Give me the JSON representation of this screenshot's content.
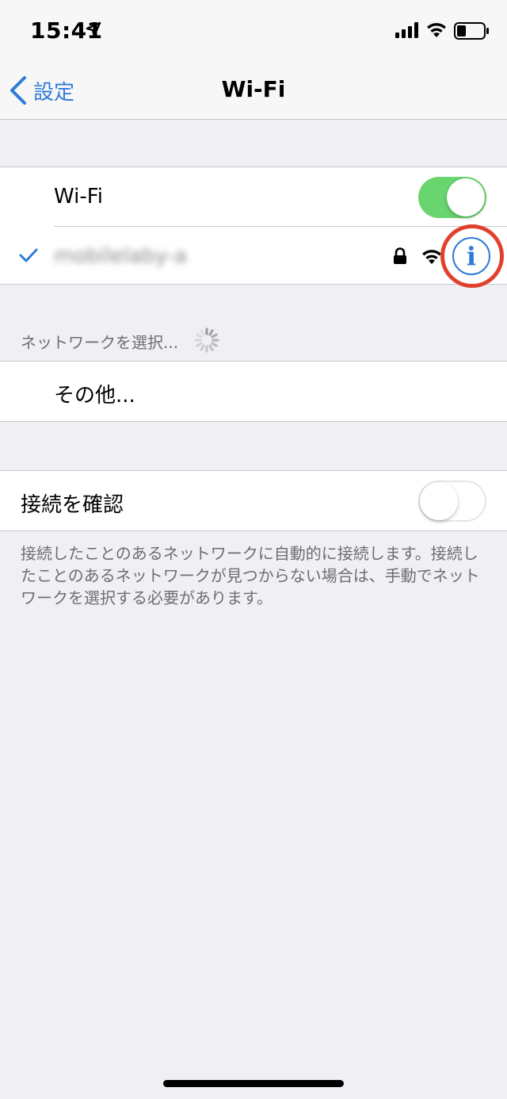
{
  "status_bar": {
    "time": "15:41",
    "icons": [
      "location-arrow-icon",
      "cellular-signal-icon",
      "wifi-icon",
      "battery-icon"
    ]
  },
  "nav": {
    "back_label": "設定",
    "title": "Wi-Fi"
  },
  "wifi_section": {
    "toggle_label": "Wi-Fi",
    "toggle_on": true,
    "connected_network": "mobilelaby-a"
  },
  "networks_section": {
    "header": "ネットワークを選択...",
    "other_label": "その他..."
  },
  "ask_section": {
    "label": "接続を確認",
    "toggle_on": false,
    "footer": "接続したことのあるネットワークに自動的に接続します。接続したことのあるネットワークが見つからない場合は、手動でネットワークを選択する必要があります。"
  },
  "info_glyph": "i",
  "colors": {
    "accent": "#2f7bd8",
    "toggle_on": "#68d56e",
    "highlight": "#e0412e",
    "background": "#efeff4"
  }
}
